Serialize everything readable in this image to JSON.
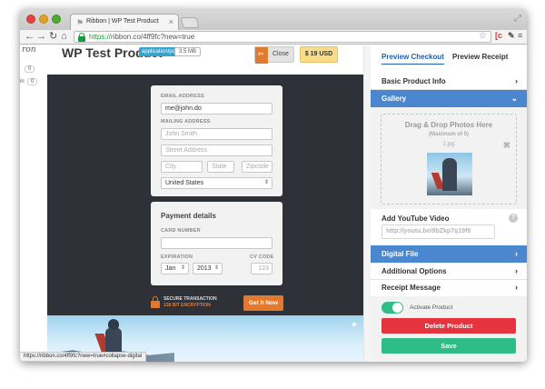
{
  "browser": {
    "tab_title": "Ribbon | WP Test Product",
    "tab_close": "×",
    "url_secure": "https://",
    "url_rest": "ribbon.co/4ff9fc?new=true",
    "status_url": "https://ribbon.co/4ff9fc?new=true#collapse-digital"
  },
  "left_column": {
    "logo": "ron",
    "count_a": "0",
    "count_b": "0",
    "count_b_prefix": "in"
  },
  "product": {
    "title": "WP Test Product",
    "type_badge": "application/pdf",
    "size_badge": "3.5 MB",
    "close_label": "Close",
    "price_label": "$ 19 USD"
  },
  "checkout": {
    "email_label": "EMAIL ADDRESS",
    "email_value": "me@john.do",
    "mailing_label": "MAILING ADDRESS",
    "name_placeholder": "John Smith",
    "street_placeholder": "Street Address",
    "city_placeholder": "City",
    "state_placeholder": "State",
    "zip_placeholder": "Zipcode",
    "country_value": "United States",
    "payment_title": "Payment details",
    "card_label": "CARD NUMBER",
    "card_value": "",
    "expiration_label": "EXPIRATION",
    "cv_label": "CV CODE",
    "month_value": "Jan",
    "year_value": "2013",
    "cv_placeholder": "123",
    "secure_line1": "SECURE TRANSACTION",
    "secure_line2": "128 BIT ENCRYPTION",
    "get_it_label": "Get It Now"
  },
  "panel": {
    "preview_checkout": "Preview Checkout",
    "preview_receipt": "Preview Receipt",
    "basic_info": "Basic Product Info",
    "gallery": "Gallery",
    "dropzone_title": "Drag & Drop Photos Here",
    "dropzone_sub": "(Maximum of 5)",
    "dropzone_file": "2.jpg",
    "youtube_label": "Add YouTube Video",
    "youtube_value": "http://youtu.be/9bZkp7q19f0",
    "digital_file": "Digital File",
    "additional_options": "Additional Options",
    "receipt_message": "Receipt Message",
    "activate_label": "Activate Product",
    "delete_label": "Delete Product",
    "save_label": "Save"
  },
  "colors": {
    "accent_blue": "#4b87cf",
    "orange": "#e3792e",
    "delete_red": "#e5343d",
    "save_green": "#2ebd86"
  }
}
